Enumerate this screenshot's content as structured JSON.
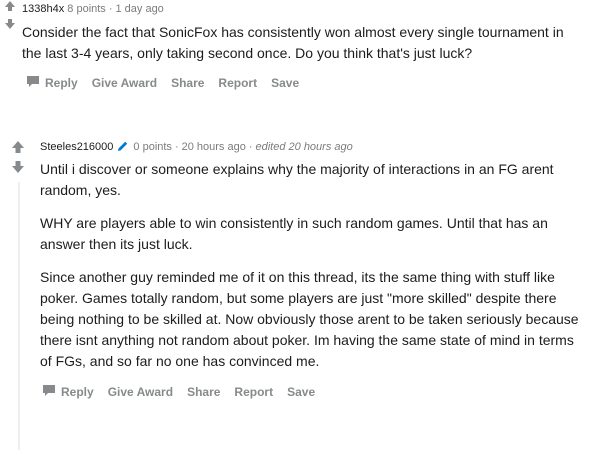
{
  "comments": [
    {
      "author": "1338h4x",
      "points": "8 points",
      "age": "1 day ago",
      "paragraphs": [
        "Consider the fact that SonicFox has consistently won almost every single tournament in the last 3-4 years, only taking second once. Do you think that's just luck?"
      ]
    },
    {
      "author": "Steeles216000",
      "points": "0 points",
      "age": "20 hours ago",
      "edited": "edited 20 hours ago",
      "paragraphs": [
        "Until i discover or someone explains why the majority of interactions in an FG arent random, yes.",
        "WHY are players able to win consistently in such random games. Until that has an answer then its just luck.",
        "Since another guy reminded me of it on this thread, its the same thing with stuff like poker. Games totally random, but some players are just \"more skilled\" despite there being nothing to be skilled at. Now obviously those arent to be taken seriously because there isnt anything not random about poker. Im having the same state of mind in terms of FGs, and so far no one has convinced me."
      ]
    }
  ],
  "actions": {
    "reply": "Reply",
    "give_award": "Give Award",
    "share": "Share",
    "report": "Report",
    "save": "Save"
  },
  "icons": {
    "upvote": "upvote-arrow-icon",
    "downvote": "downvote-arrow-icon",
    "reply": "speech-bubble-icon",
    "edit": "pencil-icon"
  },
  "colors": {
    "meta": "#7c7c7c",
    "action": "#878a8c",
    "pencil": "#0079d3",
    "thread_line": "#edeff1"
  }
}
